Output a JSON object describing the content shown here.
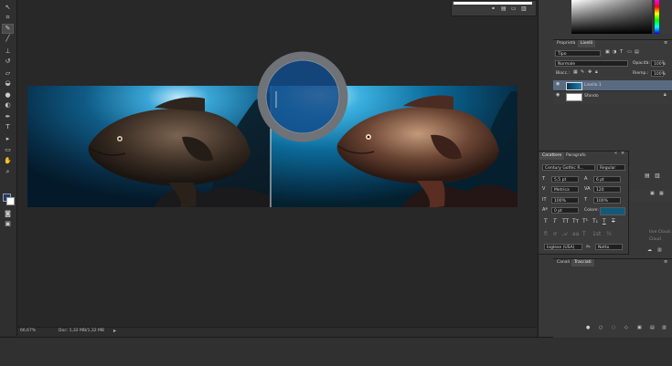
{
  "tools": [
    {
      "icon": "move-icon",
      "glyph": "↖"
    },
    {
      "icon": "crop-icon",
      "glyph": "⌗"
    },
    {
      "icon": "eyedropper-icon",
      "glyph": "✎"
    },
    {
      "icon": "brush-icon",
      "glyph": "╱"
    },
    {
      "icon": "clone-stamp-icon",
      "glyph": "⊥"
    },
    {
      "icon": "history-brush-icon",
      "glyph": "↺"
    },
    {
      "icon": "eraser-icon",
      "glyph": "▱"
    },
    {
      "icon": "paint-bucket-icon",
      "glyph": "◒"
    },
    {
      "icon": "blur-icon",
      "glyph": "●"
    },
    {
      "icon": "dodge-icon",
      "glyph": "◐"
    },
    {
      "icon": "pen-icon",
      "glyph": "✒"
    },
    {
      "icon": "type-icon",
      "glyph": "T"
    },
    {
      "icon": "path-selection-icon",
      "glyph": "▸"
    },
    {
      "icon": "shape-icon",
      "glyph": "▭"
    },
    {
      "icon": "hand-icon",
      "glyph": "✋"
    },
    {
      "icon": "zoom-icon",
      "glyph": "⌕"
    }
  ],
  "colors": {
    "foreground": "#1d3d7a",
    "background": "#ffffff",
    "layer_highlight": "#5a6a80",
    "swatch_color": "#14587a"
  },
  "status": {
    "zoom": "66,67%",
    "doc": "Doc: 1,32 MB/1,32 MB"
  },
  "layers_panel": {
    "tab_properties": "Proprietà",
    "tab_layers": "Livelli",
    "filter_kind": "Tipo",
    "blend_mode": "Normale",
    "opacity_label": "Opacità:",
    "opacity_value": "100%",
    "lock_label": "Blocc.:",
    "fill_label": "Riemp.:",
    "fill_value": "100%",
    "layers": [
      {
        "name": "Livello 1"
      },
      {
        "name": "Sfondo"
      }
    ]
  },
  "character_panel": {
    "tab_character": "Carattere",
    "tab_paragraph": "Paragrafo",
    "font_family": "Century Gothic R...",
    "font_style": "Regular",
    "font_size": "5,5 pt",
    "leading": "6 pt",
    "kerning": "Metrica",
    "tracking": "120",
    "vertical_scale": "100%",
    "horizontal_scale": "100%",
    "baseline_shift": "0 pt",
    "color_label": "Colore:",
    "language": "Inglese (USA)",
    "aa_label": "aₐ",
    "antialias": "Netto"
  },
  "channels_panel": {
    "tab_channels": "Canali",
    "tab_paths": "Tracciati"
  },
  "cloud_text": {
    "line1": "tive Cloud,",
    "line2": "Cloud"
  }
}
